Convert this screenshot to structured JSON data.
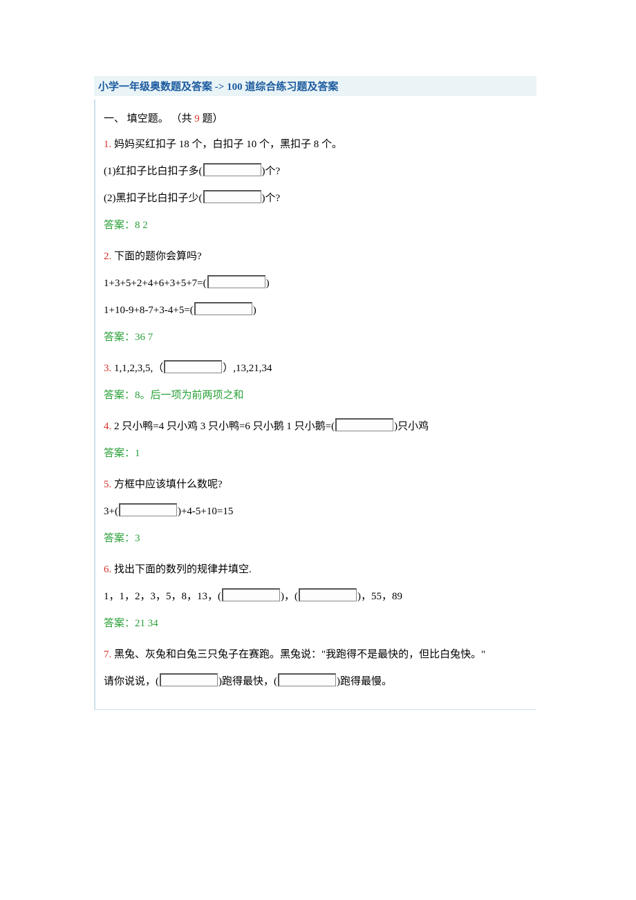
{
  "header": {
    "crumb1": "小学一年级奥数题及答案",
    "arrow": "->",
    "crumb2": "100 道综合练习题及答案"
  },
  "section": {
    "label_pre": "一、 填空题。 （共 ",
    "count": "9",
    "label_post": " 题）"
  },
  "q1": {
    "num": "1.",
    "prompt": "妈妈买红扣子 18 个，白扣子 10 个，黑扣子 8 个。",
    "sub1_pre": "(1)红扣子比白扣子多(",
    "sub1_post": ")个?",
    "sub2_pre": "(2)黑扣子比白扣子少(",
    "sub2_post": ")个?",
    "answer": "答案：8 2"
  },
  "q2": {
    "num": "2.",
    "prompt": "下面的题你会算吗?",
    "line1_pre": "1+3+5+2+4+6+3+5+7=(",
    "line1_post": ")",
    "line2_pre": "1+10-9+8-7+3-4+5=(",
    "line2_post": ")",
    "answer": "答案：36 7"
  },
  "q3": {
    "num": "3.",
    "pre": "1,1,2,3,5,（",
    "post": "）,13,21,34",
    "answer": "答案：8。后一项为前两项之和"
  },
  "q4": {
    "num": "4.",
    "pre": "2 只小鸭=4 只小鸡 3 只小鸭=6 只小鹅 1 只小鹅=(",
    "post": ")只小鸡",
    "answer": "答案：1"
  },
  "q5": {
    "num": "5.",
    "prompt": "方框中应该填什么数呢?",
    "line_pre": "3+(",
    "line_post": ")+4-5+10=15",
    "answer": "答案：3"
  },
  "q6": {
    "num": "6.",
    "prompt": "找出下面的数列的规律并填空.",
    "line_pre": "1，1，2，3，5，8，13，(",
    "line_mid": ")，(",
    "line_post": ")，55，89",
    "answer": "答案：21 34"
  },
  "q7": {
    "num": "7.",
    "prompt_a": "黑兔、灰兔和白兔三只兔子在赛跑。黑兔说：\"我跑得不是最快的，但比白兔快。\"",
    "line_pre": "请你说说，(",
    "line_mid": ")跑得最快，(",
    "line_post": ")跑得最慢。"
  }
}
